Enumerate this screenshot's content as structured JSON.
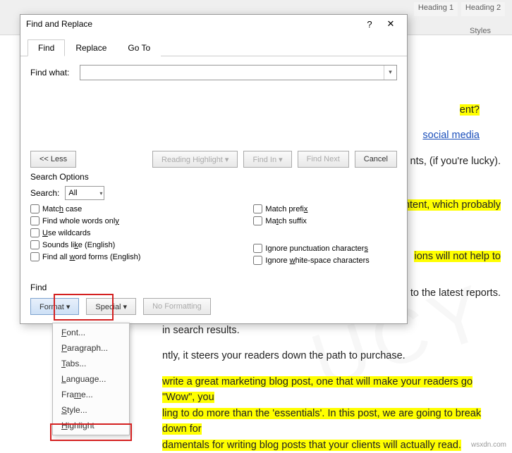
{
  "ribbon": {
    "style1": "Heading 1",
    "style2": "Heading 2",
    "group": "Styles"
  },
  "dialog": {
    "title": "Find and Replace",
    "help": "?",
    "close": "✕",
    "tabs": {
      "find": "Find",
      "replace": "Replace",
      "goto": "Go To"
    },
    "findwhat": "Find what:",
    "buttons": {
      "less": "<<  Less",
      "reading": "Reading Highlight ▾",
      "findin": "Find In ▾",
      "findnext": "Find Next",
      "cancel": "Cancel"
    },
    "searchOptions": "Search Options",
    "searchLabel": "Search:",
    "searchValue": "All",
    "checks": {
      "matchcase": "Match case",
      "whole": "Find whole words only",
      "wildcards": "Use wildcards",
      "sounds": "Sounds like (English)",
      "allforms": "Find all word forms (English)",
      "prefix": "Match prefix",
      "suffix": "Match suffix",
      "punct": "Ignore punctuation characters",
      "white": "Ignore white-space characters"
    },
    "findLabel": "Find",
    "format": "Format ▾",
    "special": "Special ▾",
    "noformat": "No Formatting"
  },
  "dropdown": {
    "font": "Font...",
    "paragraph": "Paragraph...",
    "tabs": "Tabs...",
    "language": "Language...",
    "frame": "Frame...",
    "style": "Style...",
    "highlight": "Highlight"
  },
  "doc": {
    "line1a": "ent?",
    "line2a": "social media",
    "line2b": "nts, (if you're lucky).",
    "line3a": "ntent, which probably",
    "line4a": "ions will not help to",
    "line5a": "g to the latest reports.",
    "line6": "in search results.",
    "line7": "ntly, it steers your readers down the path to purchase.",
    "line8": " write a great marketing blog post, one that will make your readers go \"Wow\", you",
    "line9": "ling to do more than the 'essentials'. In this post, we are going to break down for",
    "line10": "damentals for writing blog posts that your clients will actually read."
  },
  "footer": "wsxdn.com"
}
